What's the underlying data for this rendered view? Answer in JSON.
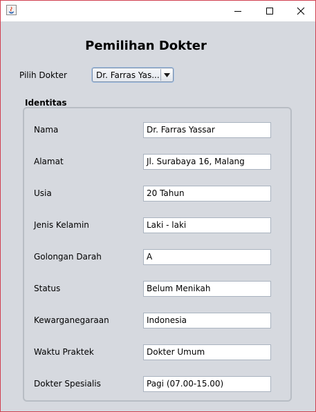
{
  "window": {
    "title": "",
    "controls": {
      "minimize": "minimize-icon",
      "maximize": "maximize-icon",
      "close": "close-icon"
    }
  },
  "form": {
    "heading": "Pemilihan Dokter",
    "pick_label": "Pilih Dokter",
    "selected_doctor": "Dr. Farras Yas..."
  },
  "identitas": {
    "title": "Identitas",
    "rows": [
      {
        "label": "Nama",
        "value": "Dr. Farras Yassar"
      },
      {
        "label": "Alamat",
        "value": "Jl. Surabaya 16, Malang"
      },
      {
        "label": "Usia",
        "value": "20 Tahun"
      },
      {
        "label": "Jenis Kelamin",
        "value": "Laki - laki"
      },
      {
        "label": "Golongan Darah",
        "value": "A"
      },
      {
        "label": "Status",
        "value": "Belum Menikah"
      },
      {
        "label": "Kewarganegaraan",
        "value": "Indonesia"
      },
      {
        "label": "Waktu Praktek",
        "value": "Dokter Umum"
      },
      {
        "label": "Dokter Spesialis",
        "value": "Pagi (07.00-15.00)"
      }
    ]
  }
}
